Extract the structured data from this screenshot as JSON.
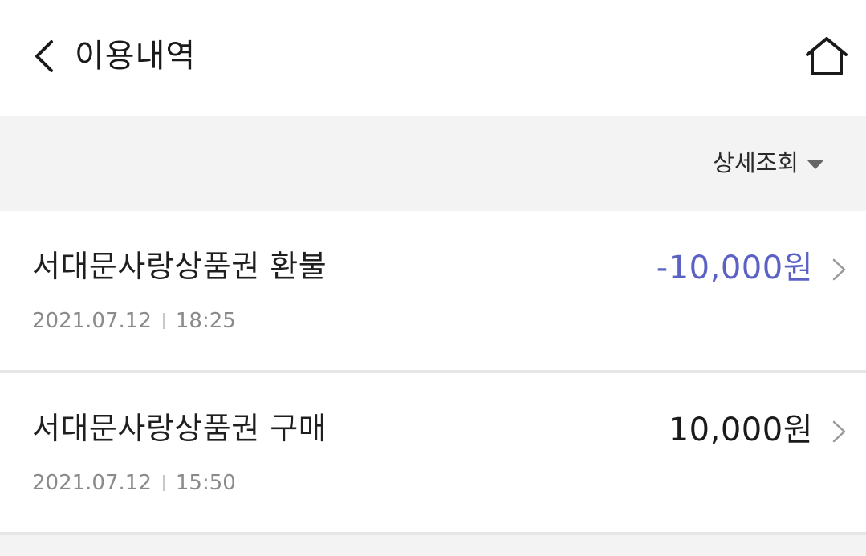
{
  "header": {
    "title": "이용내역",
    "back_icon": "chevron-left-icon",
    "home_icon": "home-icon"
  },
  "filter": {
    "label": "상세조회",
    "caret_icon": "caret-down-icon"
  },
  "transactions": [
    {
      "title": "서대문사랑상품권 환불",
      "date": "2021.07.12",
      "time": "18:25",
      "amount": "-10,000원",
      "amount_color": "#5b62c4"
    },
    {
      "title": "서대문사랑상품권 구매",
      "date": "2021.07.12",
      "time": "15:50",
      "amount": "10,000원",
      "amount_color": "#1a1a1a"
    }
  ],
  "colors": {
    "background": "#ffffff",
    "filter_bar": "#f3f3f3",
    "refund_amount": "#5b62c4",
    "meta_text": "#8a8a8a",
    "divider": "#e6e6e6"
  }
}
